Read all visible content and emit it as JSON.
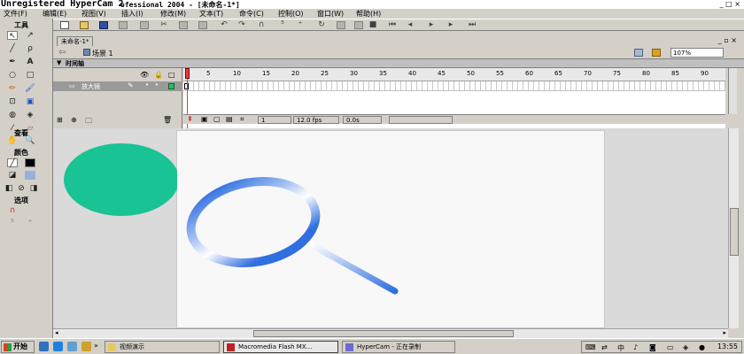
{
  "window": {
    "title_left": "Unregistered HyperCam 2",
    "title_right": "ofessional 2004 - [未命名-1*]",
    "window_buttons": "_ □ ×"
  },
  "menu": [
    "文件(F)",
    "编辑(E)",
    "视图(V)",
    "插入(I)",
    "修改(M)",
    "文本(T)",
    "命令(C)",
    "控制(O)",
    "窗口(W)",
    "帮助(H)"
  ],
  "tools_panel": {
    "header_tools": "工具",
    "header_view": "查看",
    "header_colors": "颜色",
    "header_options": "选项"
  },
  "document": {
    "tab_name": "未命名-1*",
    "scene_label": "场景 1",
    "zoom": "107%",
    "doc_window_buttons": "_ ▫ ×"
  },
  "timeline": {
    "header_label": "时间轴",
    "layer_name": "放大镜",
    "frame_numbers": [
      "1",
      "5",
      "10",
      "15",
      "20",
      "25",
      "30",
      "35",
      "40",
      "45",
      "50",
      "55",
      "60",
      "65",
      "70",
      "75",
      "80",
      "85",
      "90"
    ],
    "current_frame": "1",
    "frame_rate": "12.0 fps",
    "elapsed_time": "0.0s"
  },
  "taskbar": {
    "start_label": "开始",
    "tasks": [
      {
        "label": "视频演示",
        "icon": "folder-icon"
      },
      {
        "label": "Macromedia Flash MX...",
        "icon": "flash-icon"
      },
      {
        "label": "HyperCam - 正在录制",
        "icon": "hypercam-icon"
      }
    ],
    "clock": "13:55"
  },
  "colors": {
    "circle_fill": "#19c393",
    "magnifier_blue": "#2f6fe0",
    "stage_bg": "#f8f8f8",
    "workspace_bg": "#dadada"
  }
}
